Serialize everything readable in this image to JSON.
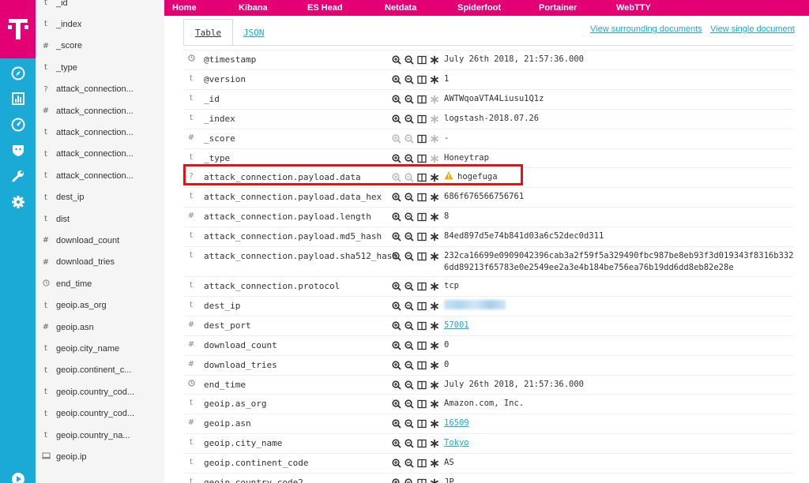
{
  "topnav": {
    "links": [
      {
        "label": "Home"
      },
      {
        "label": "Kibana"
      },
      {
        "label": "ES Head"
      },
      {
        "label": "Netdata"
      },
      {
        "label": "Spiderfoot"
      },
      {
        "label": "Portainer"
      },
      {
        "label": "WebTTY"
      }
    ]
  },
  "brand": {
    "logo_text": "T",
    "magenta": "#e20074",
    "rail_color": "#1ba9d6"
  },
  "rail_icons": [
    "compass-icon",
    "bar-chart-icon",
    "dashboard-gauge-icon",
    "shield-icon",
    "wrench-icon",
    "gear-icon",
    "play-icon"
  ],
  "fieldlist": {
    "items": [
      {
        "type": "t",
        "name": "_id"
      },
      {
        "type": "t",
        "name": "_index"
      },
      {
        "type": "#",
        "name": "_score"
      },
      {
        "type": "t",
        "name": "_type"
      },
      {
        "type": "?",
        "name": "attack_connection..."
      },
      {
        "type": "#",
        "name": "attack_connection..."
      },
      {
        "type": "t",
        "name": "attack_connection..."
      },
      {
        "type": "t",
        "name": "attack_connection..."
      },
      {
        "type": "t",
        "name": "attack_connection..."
      },
      {
        "type": "t",
        "name": "dest_ip"
      },
      {
        "type": "t",
        "name": "dist"
      },
      {
        "type": "#",
        "name": "download_count"
      },
      {
        "type": "#",
        "name": "download_tries"
      },
      {
        "type": "clock",
        "name": "end_time"
      },
      {
        "type": "t",
        "name": "geoip.as_org"
      },
      {
        "type": "#",
        "name": "geoip.asn"
      },
      {
        "type": "t",
        "name": "geoip.city_name"
      },
      {
        "type": "t",
        "name": "geoip.continent_c..."
      },
      {
        "type": "t",
        "name": "geoip.country_cod..."
      },
      {
        "type": "t",
        "name": "geoip.country_cod..."
      },
      {
        "type": "t",
        "name": "geoip.country_na..."
      },
      {
        "type": "computer",
        "name": "geoip.ip"
      }
    ]
  },
  "tabs": [
    {
      "label": "Table"
    },
    {
      "label": "JSON"
    }
  ],
  "links": {
    "surrounding": "View surrounding documents",
    "single": "View single document"
  },
  "doc": {
    "rows": [
      {
        "type": "clock",
        "field": "@timestamp",
        "value": "July 26th 2018, 21:57:36.000",
        "link": false
      },
      {
        "type": "t",
        "field": "@version",
        "value": "1",
        "link": false
      },
      {
        "type": "t",
        "field": "_id",
        "value": "AWTWqoaVTA4Liusu1Q1z",
        "link": false,
        "meta": true
      },
      {
        "type": "t",
        "field": "_index",
        "value": "logstash-2018.07.26",
        "link": false,
        "meta": true
      },
      {
        "type": "#",
        "field": "_score",
        "value": "-",
        "link": false,
        "meta": true,
        "dim": true
      },
      {
        "type": "t",
        "field": "_type",
        "value": "Honeytrap",
        "link": false,
        "meta": true
      },
      {
        "type": "?",
        "field": "attack_connection.payload.data",
        "value": "hogefuga",
        "link": false,
        "warn": true,
        "dim": true
      },
      {
        "type": "t",
        "field": "attack_connection.payload.data_hex",
        "value": "686f676566756761",
        "link": false
      },
      {
        "type": "#",
        "field": "attack_connection.payload.length",
        "value": "8",
        "link": false
      },
      {
        "type": "t",
        "field": "attack_connection.payload.md5_hash",
        "value": "84ed897d5e74b841d03a6c52dec0d311",
        "link": false
      },
      {
        "type": "t",
        "field": "attack_connection.payload.sha512_hash",
        "value": "232ca16699e0909042396cab3a2f59f5a329490fbc987be8eb93f3d019343f8316b332",
        "value2": "6dd89213f65783e0e2549ee2a3e4b184be756ea76b19dd6dd8eb82e28e",
        "link": false
      },
      {
        "type": "t",
        "field": "attack_connection.protocol",
        "value": "tcp",
        "link": false
      },
      {
        "type": "t",
        "field": "dest_ip",
        "value": "",
        "link": false,
        "blurred": true
      },
      {
        "type": "#",
        "field": "dest_port",
        "value": "57001",
        "link": true
      },
      {
        "type": "#",
        "field": "download_count",
        "value": "0",
        "link": false
      },
      {
        "type": "#",
        "field": "download_tries",
        "value": "0",
        "link": false
      },
      {
        "type": "clock",
        "field": "end_time",
        "value": "July 26th 2018, 21:57:36.000",
        "link": false
      },
      {
        "type": "t",
        "field": "geoip.as_org",
        "value": "Amazon.com, Inc.",
        "link": false
      },
      {
        "type": "#",
        "field": "geoip.asn",
        "value": "16509",
        "link": true
      },
      {
        "type": "t",
        "field": "geoip.city_name",
        "value": "Tokyo",
        "link": true
      },
      {
        "type": "t",
        "field": "geoip.continent_code",
        "value": "AS",
        "link": false
      },
      {
        "type": "t",
        "field": "geoip.country_code2",
        "value": "JP",
        "link": false
      }
    ]
  }
}
